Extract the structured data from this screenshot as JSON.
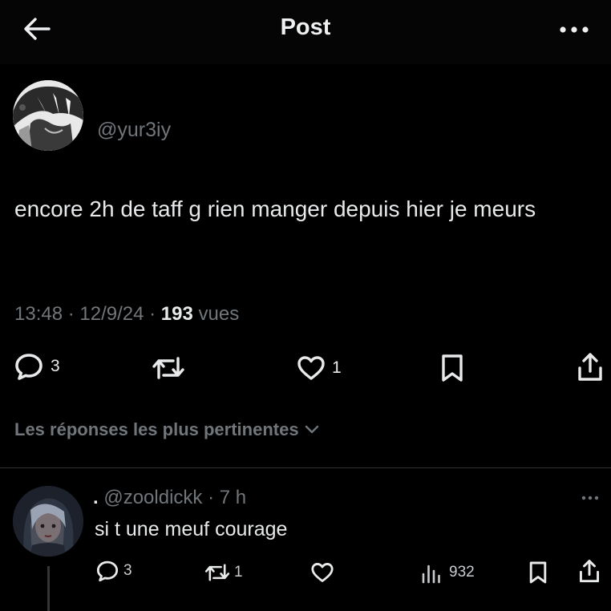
{
  "header": {
    "title": "Post",
    "back_icon": "arrow-left-icon",
    "more_icon": "more-horizontal-icon"
  },
  "post": {
    "handle": "@yur3iy",
    "text": "encore 2h de taff g rien manger depuis hier je meurs",
    "time": "13:48",
    "sep1": " · ",
    "date": "12/9/24",
    "sep2": " · ",
    "views_count": "193",
    "views_label": " vues",
    "actions": {
      "replies": "3",
      "reposts": "",
      "likes": "1"
    }
  },
  "replies_sort": {
    "label": "Les réponses les plus pertinentes"
  },
  "reply": {
    "prefix": ".",
    "handle": "@zooldickk",
    "sep": " · ",
    "time": "7 h",
    "text": "si t une meuf courage",
    "actions": {
      "replies": "3",
      "reposts": "1",
      "views": "932"
    }
  },
  "colors": {
    "background": "#000000",
    "text": "#e7e9ea",
    "secondary": "#71767b",
    "divider": "#2f3336"
  }
}
